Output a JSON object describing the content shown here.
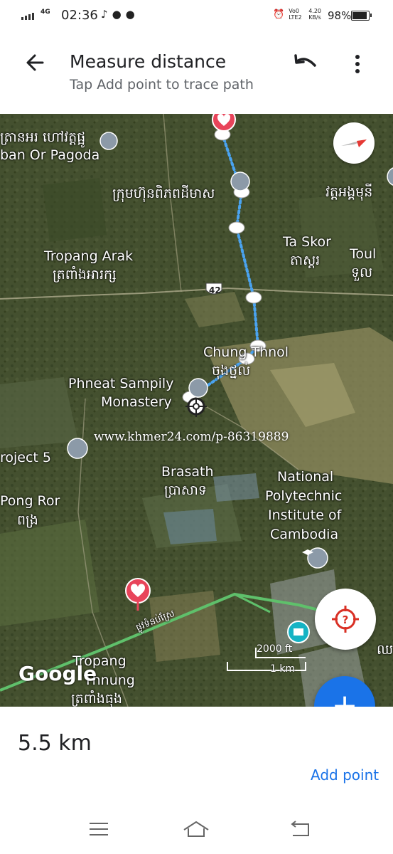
{
  "status_bar": {
    "network": "4G",
    "time": "02:36",
    "net_type": "Vo0 LTE2",
    "speed": "4.20 KB/s",
    "battery_percent": "98%"
  },
  "app_bar": {
    "title": "Measure distance",
    "subtitle": "Tap Add point to trace path"
  },
  "map": {
    "labels": {
      "pagoda_km": "ត្រានអរ ហៅវត្តផ្អូ",
      "pagoda_en": "ban Or Pagoda",
      "company_km": "ក្រុមហ៊ុនពិភពដីមាស",
      "wat_km": "វត្តអង្គមុនី",
      "ta_skor_en": "Ta Skor",
      "ta_skor_km": "តាស្គរ",
      "toul_en": "Toul",
      "toul_km": "ទួល",
      "tropang_arak_en": "Tropang Arak",
      "tropang_arak_km": "ត្រពាំងអារក្ស",
      "road_number": "42",
      "chung_thnol_en": "Chung Thnol",
      "chung_thnol_km": "ចុងថ្នល់",
      "phneat_line1": "Phneat Sampily",
      "phneat_line2": "Monastery",
      "project5": "roject 5",
      "brasath_en": "Brasath",
      "brasath_km": "ប្រាសាទ",
      "npic_line1": "National",
      "npic_line2": "Polytechnic",
      "npic_line3": "Institute of",
      "npic_line4": "Cambodia",
      "pong_ror_en": "Pong Ror",
      "pong_ror_km": "ពង្រ",
      "road_km": "ផ្លូវទំនប់ស្រែ",
      "tropang_line1": "Tropang",
      "tropang_line2": "Thnung",
      "tropang_km": "ត្រពាំងធុង",
      "right_edge_km": "ឈ"
    },
    "watermark": "www.khmer24.com/p-86319889",
    "google_logo": "Google",
    "scale_ft": "2000 ft",
    "scale_km": "1 km",
    "accent_blue": "#1a73e8",
    "pin_red": "#e8445a",
    "locate_red": "#d93025"
  },
  "bottom": {
    "distance": "5.5 km",
    "add_point_label": "Add point",
    "fab_icon": "+"
  },
  "nav": {
    "menu_icon": "menu-icon",
    "home_icon": "home-icon",
    "back_icon": "return-icon"
  }
}
